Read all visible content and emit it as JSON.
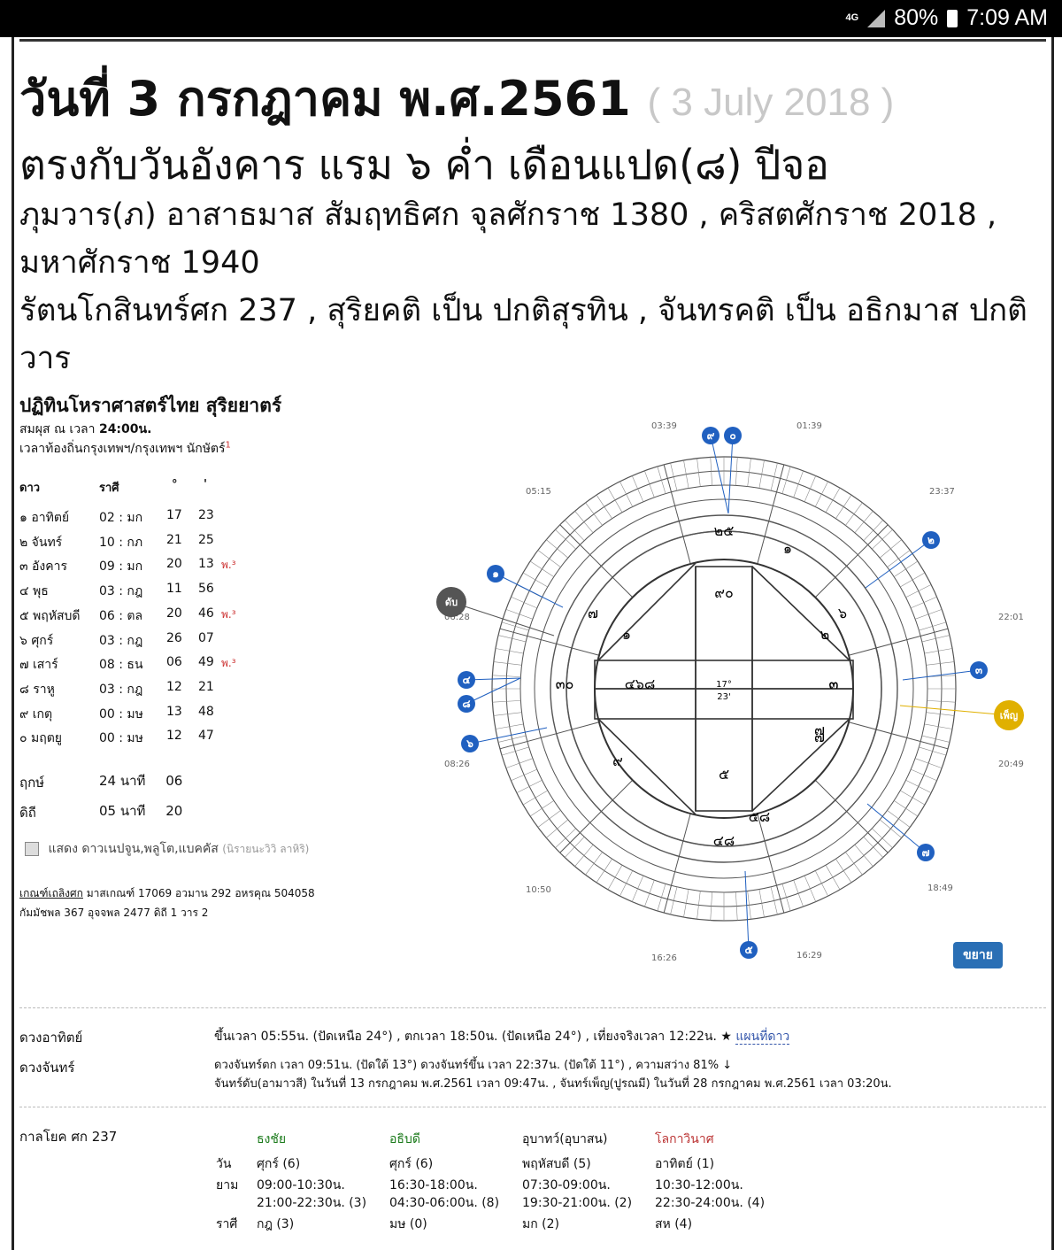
{
  "status_bar": {
    "network": "4G",
    "battery": "80%",
    "time": "7:09 AM"
  },
  "header": {
    "title_th": "วันที่ 3 กรกฎาคม พ.ศ.2561",
    "title_en": "( 3 July 2018 )",
    "line2": "ตรงกับวันอังคาร แรม ๖ ค่ำ เดือนแปด(๘) ปีจอ",
    "line3": "ภุมวาร(ภ) อาสาธมาส สัมฤทธิศก จุลศักราช 1380 , คริสตศักราช 2018 , มหาศักราช 1940",
    "line4": "รัตนโกสินทร์ศก 237 , สุริยคติ เป็น ปกติสุรทิน , จันทรคติ เป็น อธิกมาส ปกติวาร"
  },
  "panchang": {
    "title": "ปฏิทินโหราศาสตร์ไทย สุริยยาตร์",
    "sub1_prefix": "สมผุส ณ เวลา",
    "sub1_time": "24:00น.",
    "sub2": "เวลาท้องถิ่นกรุงเทพฯ/กรุงเทพฯ นักษัตร์",
    "sub2_sup": "1",
    "headers": [
      "ดาว",
      "ราศี",
      "°",
      "'"
    ],
    "rows": [
      {
        "planet": "๑ อาทิตย์",
        "sign": "02 : มก",
        "deg": "17",
        "min": "23",
        "note": ""
      },
      {
        "planet": "๒ จันทร์",
        "sign": "10 : กภ",
        "deg": "21",
        "min": "25",
        "note": ""
      },
      {
        "planet": "๓ อังคาร",
        "sign": "09 : มก",
        "deg": "20",
        "min": "13",
        "note": "พ.³"
      },
      {
        "planet": "๔ พุธ",
        "sign": "03 : กฎ",
        "deg": "11",
        "min": "56",
        "note": ""
      },
      {
        "planet": "๕ พฤหัสบดี",
        "sign": "06 : ตล",
        "deg": "20",
        "min": "46",
        "note": "พ.³"
      },
      {
        "planet": "๖ ศุกร์",
        "sign": "03 : กฎ",
        "deg": "26",
        "min": "07",
        "note": ""
      },
      {
        "planet": "๗ เสาร์",
        "sign": "08 : ธน",
        "deg": "06",
        "min": "49",
        "note": "พ.³"
      },
      {
        "planet": "๘ ราหู",
        "sign": "03 : กฎ",
        "deg": "12",
        "min": "21",
        "note": ""
      },
      {
        "planet": "๙ เกตุ",
        "sign": "00 : มษ",
        "deg": "13",
        "min": "48",
        "note": ""
      },
      {
        "planet": "๐ มฤตยู",
        "sign": "00 : มษ",
        "deg": "12",
        "min": "47",
        "note": ""
      }
    ],
    "reuk_label": "ฤกษ์",
    "reuk_val": "24",
    "reuk_unit": "นาที",
    "reuk_val2": "06",
    "diti_label": "ดิถี",
    "diti_val": "05",
    "diti_unit": "นาที",
    "diti_val2": "20",
    "checkbox_label": "แสดง ดาวเนปจูน,พลูโต,แบคคัส",
    "checkbox_note": "(นิรายนะวิวิ ลาหิริ)",
    "kt_line1_a": "เกณฑ์เถลิงศก",
    "kt_line1_b": "มาสเกณฑ์  17069  อวมาน  292  อหรคุณ  504058",
    "kt_line2": "กัมมัชพล  367  อุจจพล       2477   ดิถี       1      วาร         2"
  },
  "chart": {
    "center_deg": "17°",
    "center_min": "23'",
    "expand_button": "ขยาย",
    "times": [
      "03:39",
      "01:39",
      "23:37",
      "22:01",
      "20:49",
      "18:49",
      "16:29",
      "16:26",
      "10:50",
      "08:26",
      "06:28",
      "05:15"
    ],
    "houses": [
      "๒๕",
      "๑",
      "๖",
      "๓",
      "๗",
      "๕๘",
      "๔๘",
      "๙",
      "๓๐",
      "๗",
      "๙๐",
      "๑",
      "๒",
      "๔๖๘",
      "๗",
      "๕",
      "๓"
    ],
    "markers": [
      "๙",
      "๐",
      "๒",
      "๓",
      "เพ็ญ",
      "๗",
      "๕",
      "๖",
      "๘",
      "๔",
      "๑",
      "ดับ"
    ]
  },
  "sun": {
    "label": "ดวงอาทิตย์",
    "text": "ขึ้นเวลา 05:55น. (ปัดเหนือ 24°) , ตกเวลา 18:50น. (ปัดเหนือ 24°) , เที่ยงจริงเวลา 12:22น. ★",
    "link": "แผนที่ดาว"
  },
  "moon": {
    "label": "ดวงจันทร์",
    "line1": "ดวงจันทร์ตก เวลา 09:51น. (ปัดใต้ 13°) ดวงจันทร์ขึ้น เวลา 22:37น. (ปัดใต้ 11°) , ความสว่าง 81% ↓",
    "line2": "จันทร์ดับ(อามาวสี) ในวันที่ 13 กรกฎาคม พ.ศ.2561 เวลา 09:47น. , จันทร์เพ็ญ(ปูรณมี) ในวันที่ 28 กรกฎาคม พ.ศ.2561 เวลา 03:20น."
  },
  "kalayok": {
    "label": "กาลโยค ศก 237",
    "cols": [
      "ธงชัย",
      "อธิบดี",
      "อุบาทว์(อุบาสน)",
      "โลกาวินาศ"
    ],
    "row_wan": "วัน",
    "wan": [
      "ศุกร์ (6)",
      "ศุกร์ (6)",
      "พฤหัสบดี (5)",
      "อาทิตย์ (1)"
    ],
    "row_yam": "ยาม",
    "yam1": [
      "09:00-10:30น.",
      "16:30-18:00น.",
      "07:30-09:00น.",
      "10:30-12:00น."
    ],
    "yam2": [
      "21:00-22:30น. (3)",
      "04:30-06:00น. (8)",
      "19:30-21:00น. (2)",
      "22:30-24:00น. (4)"
    ],
    "row_rasi": "ราศี",
    "rasi": [
      "กฎ (3)",
      "มษ (0)",
      "มก (2)",
      "สห (4)"
    ]
  }
}
